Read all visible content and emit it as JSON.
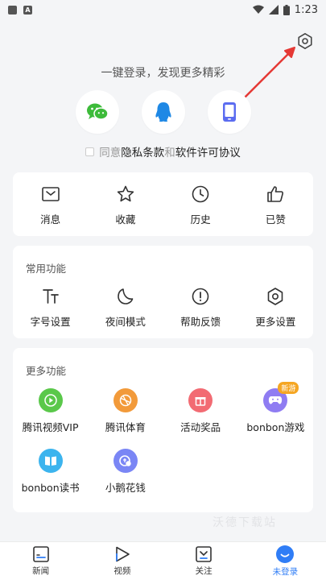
{
  "status_bar": {
    "time": "1:23"
  },
  "login": {
    "title": "一键登录，发现更多精彩",
    "methods": [
      "wechat",
      "qq",
      "phone"
    ],
    "agreement": {
      "prefix": "同意",
      "privacy": "隐私条款",
      "and": "和",
      "license": "软件许可协议"
    }
  },
  "quick_actions": [
    {
      "label": "消息",
      "icon": "mail-icon"
    },
    {
      "label": "收藏",
      "icon": "star-icon"
    },
    {
      "label": "历史",
      "icon": "clock-icon"
    },
    {
      "label": "已赞",
      "icon": "thumbs-up-icon"
    }
  ],
  "common_functions": {
    "title": "常用功能",
    "items": [
      {
        "label": "字号设置",
        "icon": "font-size-icon"
      },
      {
        "label": "夜间模式",
        "icon": "moon-icon"
      },
      {
        "label": "帮助反馈",
        "icon": "help-icon"
      },
      {
        "label": "更多设置",
        "icon": "hex-settings-icon"
      }
    ]
  },
  "more_functions": {
    "title": "更多功能",
    "items": [
      {
        "label": "腾讯视频VIP",
        "icon": "video-play-icon",
        "color": "#5ac84a"
      },
      {
        "label": "腾讯体育",
        "icon": "ball-icon",
        "color": "#f29a3a"
      },
      {
        "label": "活动奖品",
        "icon": "gift-icon",
        "color": "#f26b73"
      },
      {
        "label": "bonbon游戏",
        "icon": "gamepad-icon",
        "color": "#8f7cf2",
        "badge": "新游"
      },
      {
        "label": "bonbon读书",
        "icon": "book-icon",
        "color": "#3cb4ee"
      },
      {
        "label": "小鹅花钱",
        "icon": "wallet-icon",
        "color": "#7a86f5"
      }
    ]
  },
  "watermark": "沃德下载站",
  "tabs": [
    {
      "label": "新闻",
      "icon": "news-icon"
    },
    {
      "label": "视频",
      "icon": "video-icon"
    },
    {
      "label": "关注",
      "icon": "follow-icon"
    },
    {
      "label": "未登录",
      "icon": "profile-icon",
      "active": true
    }
  ],
  "colors": {
    "accent": "#2f7df6",
    "background": "#f4f5f7",
    "arrow": "#e53935"
  }
}
